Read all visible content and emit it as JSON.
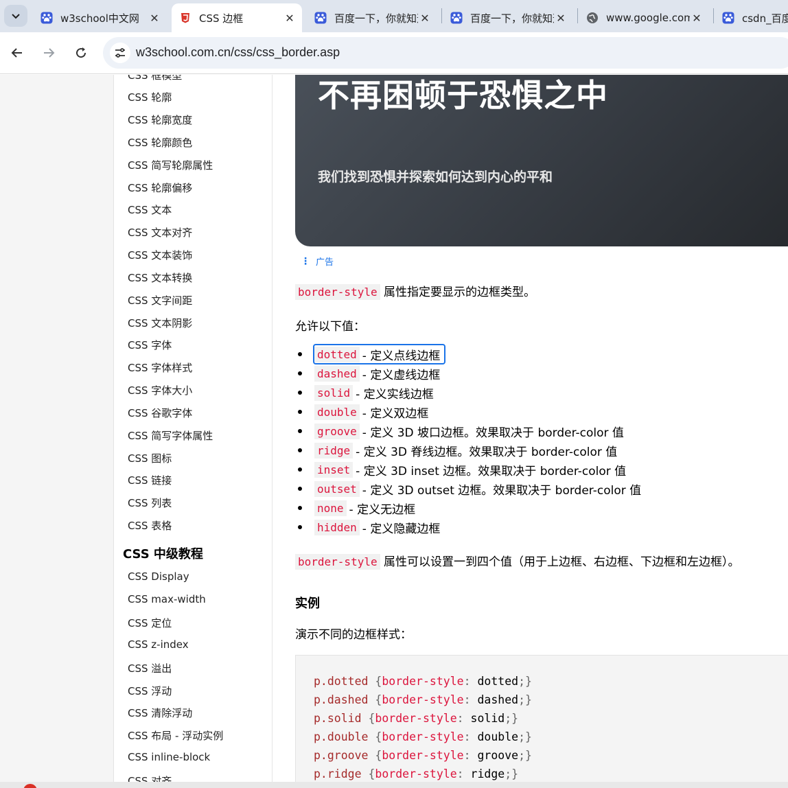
{
  "tabs": [
    {
      "title": "w3school中文网",
      "favicon": "baidu-paw-icon",
      "active": false
    },
    {
      "title": "CSS 边框",
      "favicon": "w3school-shield-icon",
      "active": true
    },
    {
      "title": "百度一下，你就知道",
      "favicon": "baidu-paw-icon",
      "active": false
    },
    {
      "title": "百度一下，你就知道",
      "favicon": "baidu-paw-icon",
      "active": false
    },
    {
      "title": "www.google.com",
      "favicon": "globe-icon",
      "active": false
    },
    {
      "title": "csdn_百度搜索",
      "favicon": "baidu-paw-icon",
      "active": false
    }
  ],
  "address": {
    "url": "w3school.com.cn/css/css_border.asp"
  },
  "sidebar": {
    "items": [
      "CSS 框模型",
      "CSS 轮廓",
      "CSS 轮廓宽度",
      "CSS 轮廓颜色",
      "CSS 简写轮廓属性",
      "CSS 轮廓偏移",
      "CSS 文本",
      "CSS 文本对齐",
      "CSS 文本装饰",
      "CSS 文本转换",
      "CSS 文字间距",
      "CSS 文本阴影",
      "CSS 字体",
      "CSS 字体样式",
      "CSS 字体大小",
      "CSS 谷歌字体",
      "CSS 简写字体属性",
      "CSS 图标",
      "CSS 链接",
      "CSS 列表",
      "CSS 表格"
    ],
    "heading": "CSS 中级教程",
    "items2": [
      "CSS Display",
      "CSS max-width",
      "CSS 定位",
      "CSS z-index",
      "CSS 溢出",
      "CSS 浮动",
      "CSS 清除浮动",
      "CSS 布局 - 浮动实例",
      "CSS inline-block",
      "CSS 对齐"
    ]
  },
  "ad": {
    "headline": "不再困顿于恐惧之中",
    "subtitle": "我们找到恐惧并探索如何达到内心的平和",
    "label": "广告"
  },
  "content": {
    "intro_code": "border-style",
    "intro_text": "属性指定要显示的边框类型。",
    "allowed": "允许以下值：",
    "values": [
      {
        "code": "dotted",
        "text": "- 定义点线边框"
      },
      {
        "code": "dashed",
        "text": "- 定义虚线边框"
      },
      {
        "code": "solid",
        "text": "- 定义实线边框"
      },
      {
        "code": "double",
        "text": "- 定义双边框"
      },
      {
        "code": "groove",
        "text": "- 定义 3D 坡口边框。效果取决于 border-color 值"
      },
      {
        "code": "ridge",
        "text": "- 定义 3D 脊线边框。效果取决于 border-color 值"
      },
      {
        "code": "inset",
        "text": "- 定义 3D inset 边框。效果取决于 border-color 值"
      },
      {
        "code": "outset",
        "text": "- 定义 3D outset 边框。效果取决于 border-color 值"
      },
      {
        "code": "none",
        "text": "- 定义无边框"
      },
      {
        "code": "hidden",
        "text": "- 定义隐藏边框"
      }
    ],
    "multi_code": "border-style",
    "multi_text": "属性可以设置一到四个值（用于上边框、右边框、下边框和左边框）。",
    "example_title": "实例",
    "example_desc": "演示不同的边框样式：",
    "code_lines": [
      {
        "sel": "p.dotted",
        "prop": "border-style",
        "val": "dotted"
      },
      {
        "sel": "p.dashed",
        "prop": "border-style",
        "val": "dashed"
      },
      {
        "sel": "p.solid",
        "prop": "border-style",
        "val": "solid"
      },
      {
        "sel": "p.double",
        "prop": "border-style",
        "val": "double"
      },
      {
        "sel": "p.groove",
        "prop": "border-style",
        "val": "groove"
      },
      {
        "sel": "p.ridge",
        "prop": "border-style",
        "val": "ridge"
      }
    ]
  }
}
